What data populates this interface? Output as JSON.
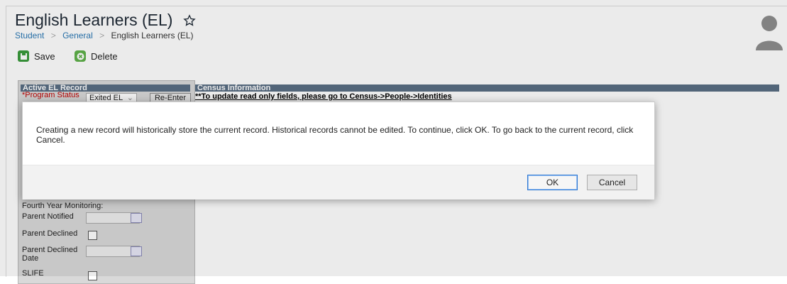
{
  "header": {
    "title": "English Learners (EL)",
    "breadcrumb": [
      "Student",
      "General",
      "English Learners (EL)"
    ]
  },
  "toolbar": {
    "save_label": "Save",
    "delete_label": "Delete"
  },
  "panel_left": {
    "header": "Active EL Record",
    "program_status_label": "*Program Status",
    "program_status_value": "Exited EL",
    "reenter_label": "Re-Enter",
    "fourth_year_label": "Fourth Year Monitoring:",
    "parent_notified_label": "Parent Notified",
    "parent_declined_label": "Parent Declined",
    "parent_declined_date_label": "Parent Declined Date",
    "slife_label": "SLIFE"
  },
  "panel_census": {
    "header": "Census Information",
    "note": "**To update read only fields, please go to Census->People->Identities"
  },
  "dialog": {
    "message": "Creating a new record will historically store the current record. Historical records cannot be edited. To continue, click OK. To go back to the current record, click Cancel.",
    "ok_label": "OK",
    "cancel_label": "Cancel"
  },
  "colors": {
    "link": "#2a78b5",
    "section_header": "#5a6e84",
    "required": "#c00000",
    "save_icon": "#3a9b3c",
    "delete_icon": "#5fb14a"
  }
}
